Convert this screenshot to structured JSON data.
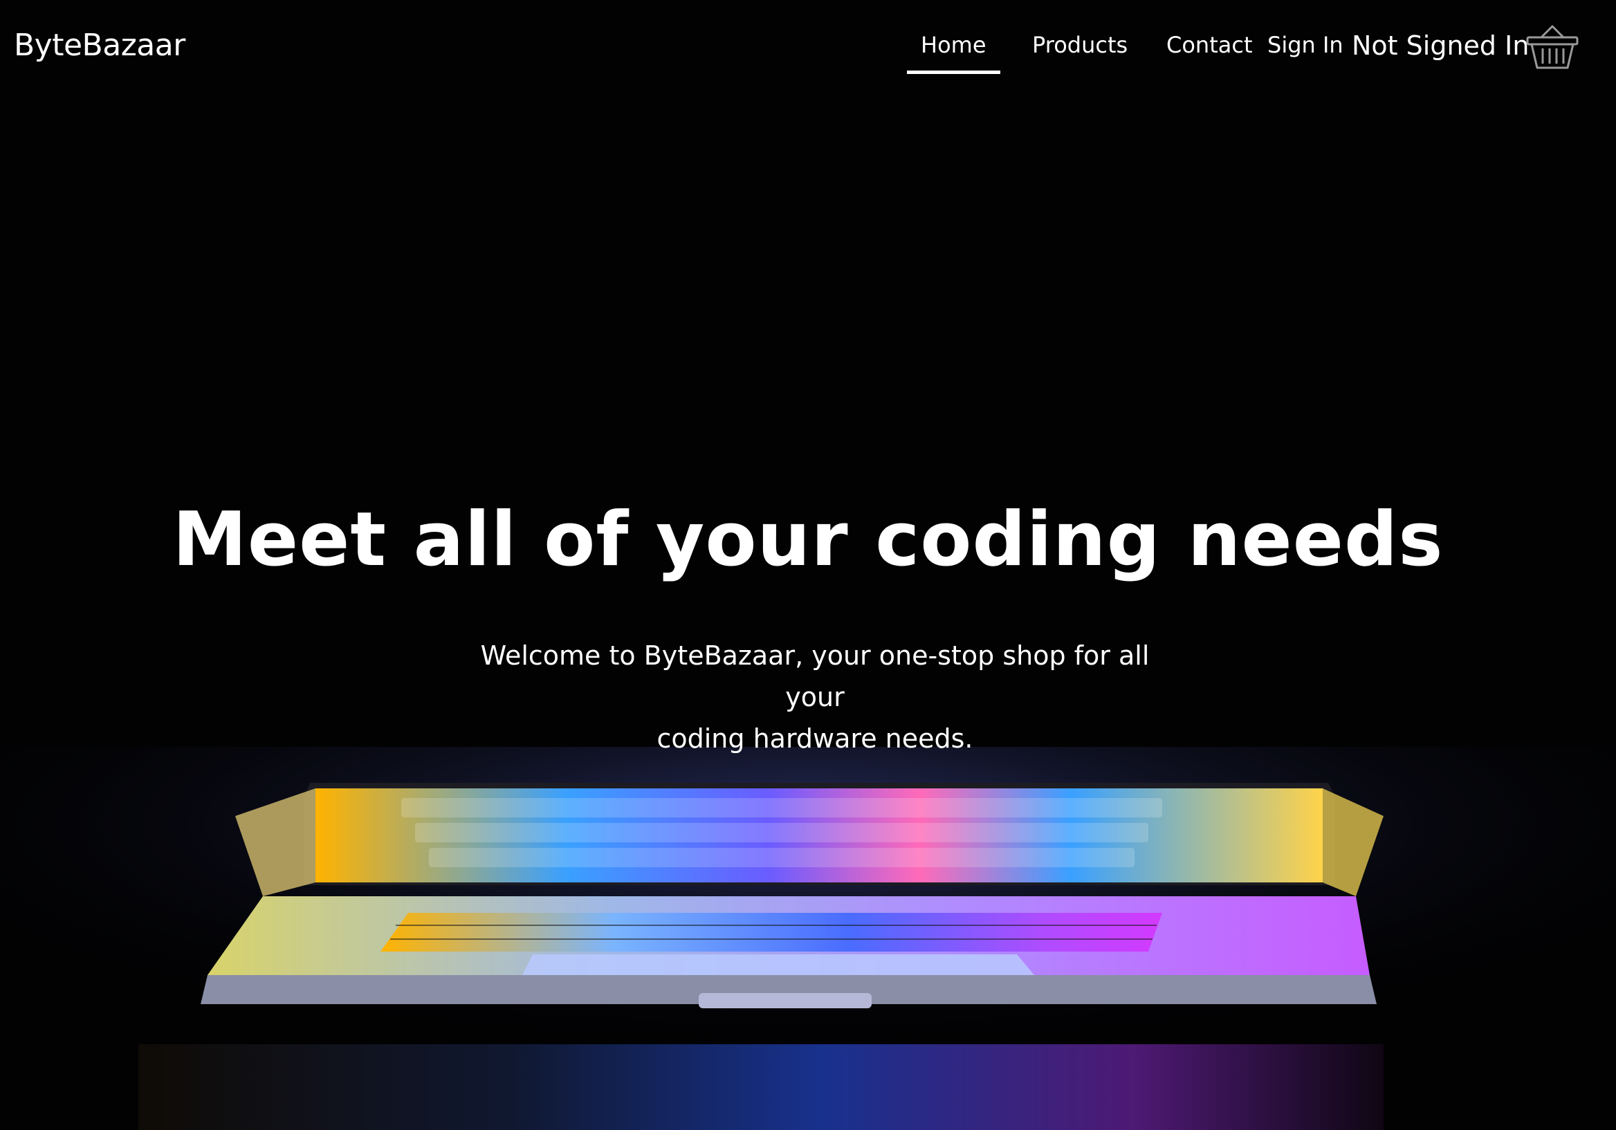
{
  "header": {
    "brand": "ByteBazaar",
    "nav": [
      {
        "label": "Home",
        "active": true
      },
      {
        "label": "Products",
        "active": false
      },
      {
        "label": "Contact",
        "active": false
      },
      {
        "label": "Sign In",
        "active": false
      }
    ],
    "auth_status": "Not Signed In",
    "cart_icon": "basket-icon"
  },
  "hero": {
    "title": "Meet all of your coding needs",
    "subtitle_line1": "Welcome to ByteBazaar, your one-stop shop for all your",
    "subtitle_line2": "coding hardware needs."
  },
  "background": {
    "image_icon": "laptop-rainbow-image",
    "colors": [
      "#ffb300",
      "#3aa0ff",
      "#b04cff",
      "#ff3aa6",
      "#2a58ff"
    ]
  }
}
